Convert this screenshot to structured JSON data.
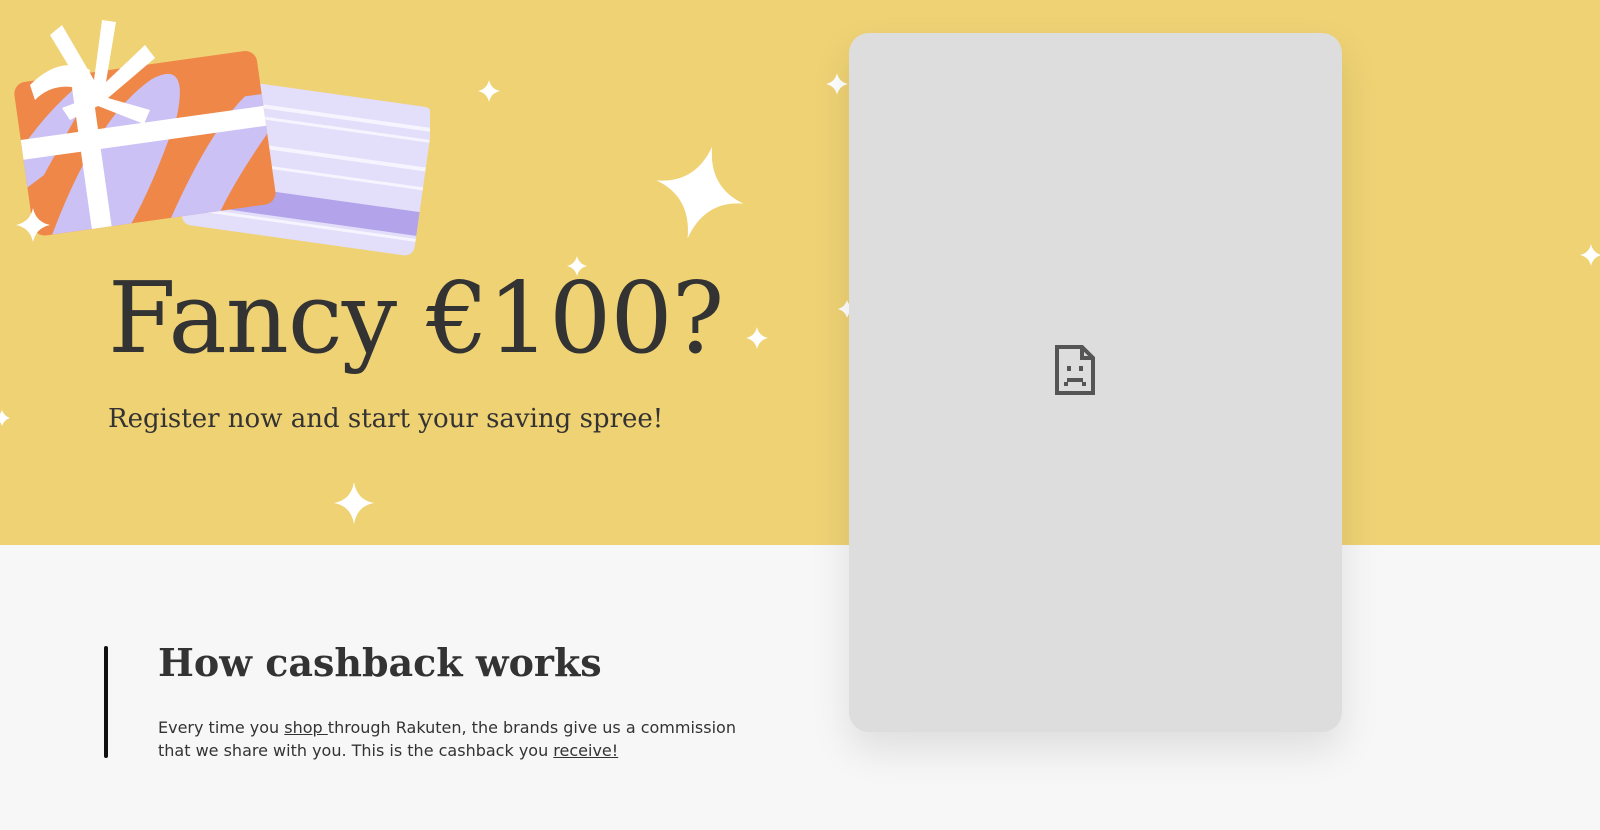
{
  "hero": {
    "title": "Fancy €100?",
    "subtitle": "Register now and start your saving spree!",
    "background_color": "#efd274"
  },
  "how_it_works": {
    "title": "How cashback works",
    "text_part1": "Every time you ",
    "link_shop": "shop ",
    "text_part2": "through Rakuten, the brands give us a commission that we share with you. This is the cashback you ",
    "link_receive": "receive!"
  },
  "embedded_form": {
    "icon": "broken-document-icon",
    "background_color": "#dddddd"
  },
  "colors": {
    "accent_orange": "#ee8748",
    "accent_lavender": "#cbc1f5",
    "text": "#333333"
  }
}
